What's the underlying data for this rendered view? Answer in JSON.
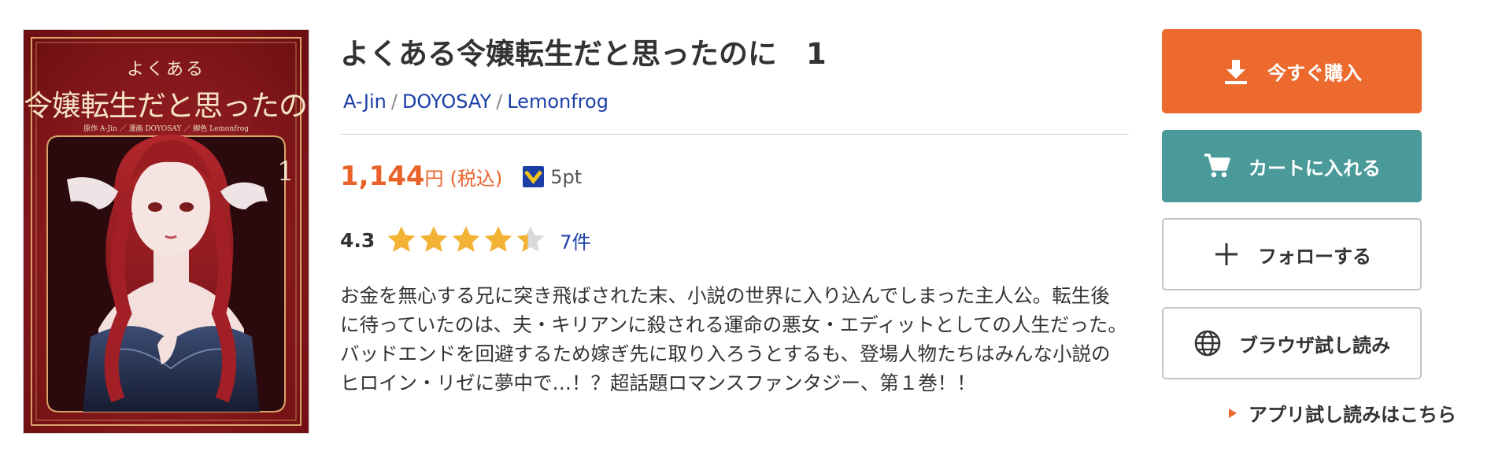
{
  "cover": {
    "sub_title": "よくある",
    "main_title": "令嬢転生だと思ったのに",
    "credits": "原作 A-Jin ／ 漫画 DOYOSAY ／ 脚色 Lemonfrog",
    "volume": "1"
  },
  "product": {
    "title": "よくある令嬢転生だと思ったのに　1",
    "authors": [
      "A-Jin",
      "DOYOSAY",
      "Lemonfrog"
    ],
    "author_separator": "/",
    "price": "1,144",
    "currency": "円",
    "tax_label": "(税込)",
    "points": "5pt",
    "rating": "4.3",
    "rating_value": 4.3,
    "rating_max": 5,
    "review_count": "7件",
    "description": "お金を無心する兄に突き飛ばされた末、小説の世界に入り込んでしまった主人公。転生後に待っていたのは、夫・キリアンに殺される運命の悪女・エディットとしての人生だった。バッドエンドを回避するため嫁ぎ先に取り入ろうとするも、登場人物たちはみんな小説のヒロイン・リゼに夢中で…！？超話題ロマンスファンタジー、第１巻！！"
  },
  "actions": {
    "buy_label": "今すぐ購入",
    "cart_label": "カートに入れる",
    "follow_label": "フォローする",
    "browser_label": "ブラウザ試し読み",
    "app_label": "アプリ試し読みはこちら"
  },
  "icons": {
    "download": "download-icon",
    "cart": "cart-icon",
    "plus": "plus-icon",
    "globe": "globe-icon",
    "triangle": "triangle-right-icon",
    "points": "points-icon",
    "star": "star-icon"
  },
  "colors": {
    "accent_orange": "#ec6a2d",
    "price_orange": "#e8622a",
    "teal": "#4b9a9a",
    "link_blue": "#1a3ea6",
    "star_gold": "#f2b233",
    "star_empty": "#d9d9d9",
    "cover_red": "#8e1a1b"
  }
}
